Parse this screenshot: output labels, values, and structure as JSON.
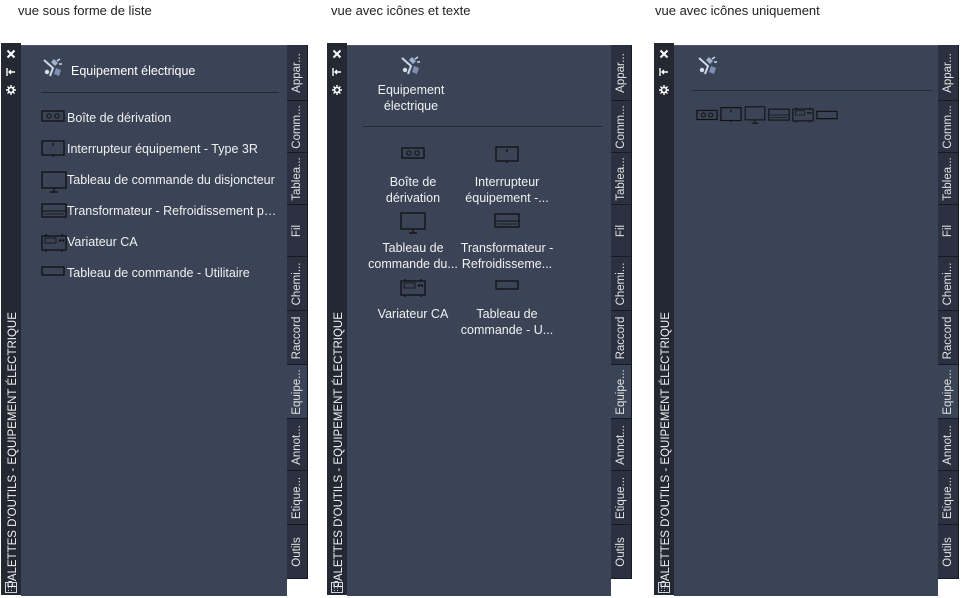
{
  "captions": [
    "vue sous forme de liste",
    "vue avec icônes et texte",
    "vue avec icônes uniquement"
  ],
  "palette": {
    "title": "PALETTES D'OUTILS - EQUIPEMENT ÉLECTRIQUE",
    "tabs": [
      "Appar...",
      "Comm...",
      "Tablea...",
      "Fil",
      "Chemi...",
      "Raccord",
      "Equipe...",
      "Annot...",
      "Etique...",
      "Outils"
    ],
    "active_tab_index": 6,
    "group": {
      "label": "Equipement électrique",
      "label_wrapped": [
        "Equipement",
        "électrique"
      ]
    },
    "tools": [
      {
        "label": "Boîte de dérivation",
        "label_wrapped": [
          "Boîte de",
          "dérivation"
        ],
        "icon": "junction-box-icon"
      },
      {
        "label": "Interrupteur équipement - Type 3R",
        "label_wrapped": [
          "Interrupteur",
          "équipement  -..."
        ],
        "icon": "equipment-switch-icon"
      },
      {
        "label": "Tableau de commande du disjoncteur",
        "label_wrapped": [
          "Tableau de",
          "commande  du..."
        ],
        "icon": "breaker-panel-icon"
      },
      {
        "label": "Transformateur  -  Refroidissement  pa...",
        "label_wrapped": [
          "Transformateur -",
          "Refroidisseme..."
        ],
        "icon": "transformer-icon"
      },
      {
        "label": "Variateur CA",
        "label_wrapped": [
          "Variateur CA"
        ],
        "icon": "ac-drive-icon"
      },
      {
        "label": "Tableau de commande - Utilitaire",
        "label_wrapped": [
          "Tableau de",
          "commande -  U..."
        ],
        "icon": "utility-panel-icon"
      }
    ]
  },
  "colors": {
    "panel_bg": "#3b4456",
    "strip_bg": "#232833",
    "tab_bg": "#2b3140"
  }
}
